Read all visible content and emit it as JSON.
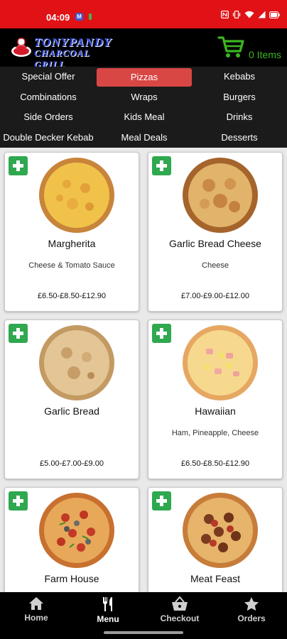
{
  "status_bar": {
    "time": "04:09",
    "badge": "M",
    "colors": {
      "background": "#e01216"
    },
    "icons": [
      "nfc-icon",
      "vibrate-icon",
      "wifi-icon",
      "signal-icon",
      "battery-icon"
    ]
  },
  "header": {
    "logo_line1": "TONYPANDY",
    "logo_line2": "CHARCOAL GRILL",
    "cart_label": "0 Items",
    "cart_icon": "shopping-cart-icon",
    "colors": {
      "cart": "#3cb521",
      "logo": "#2c48d8"
    }
  },
  "categories": [
    {
      "label": "Special Offer",
      "active": false
    },
    {
      "label": "Pizzas",
      "active": true
    },
    {
      "label": "Kebabs",
      "active": false
    },
    {
      "label": "Combinations",
      "active": false
    },
    {
      "label": "Wraps",
      "active": false
    },
    {
      "label": "Burgers",
      "active": false
    },
    {
      "label": "Side Orders",
      "active": false
    },
    {
      "label": "Kids Meal",
      "active": false
    },
    {
      "label": "Drinks",
      "active": false
    },
    {
      "label": "Double Decker Kebab",
      "active": false
    },
    {
      "label": "Meal Deals",
      "active": false
    },
    {
      "label": "Desserts",
      "active": false
    }
  ],
  "products": [
    {
      "name": "Margherita",
      "description": "Cheese & Tomato Sauce",
      "price": "£6.50-£8.50-£12.90"
    },
    {
      "name": "Garlic Bread Cheese",
      "description": "Cheese",
      "price": "£7.00-£9.00-£12.00"
    },
    {
      "name": "Garlic Bread",
      "description": "",
      "price": "£5.00-£7.00-£9.00"
    },
    {
      "name": "Hawaiian",
      "description": "Ham, Pineapple, Cheese",
      "price": "£6.50-£8.50-£12.90"
    },
    {
      "name": "Farm House",
      "description": "",
      "price": ""
    },
    {
      "name": "Meat Feast",
      "description": "",
      "price": ""
    }
  ],
  "bottom_nav": [
    {
      "label": "Home",
      "icon": "home-icon",
      "active": false
    },
    {
      "label": "Menu",
      "icon": "fork-knife-icon",
      "active": true
    },
    {
      "label": "Checkout",
      "icon": "basket-icon",
      "active": false
    },
    {
      "label": "Orders",
      "icon": "star-icon",
      "active": false
    }
  ],
  "colors": {
    "accent": "#d94745",
    "add_button": "#2fa84f"
  }
}
